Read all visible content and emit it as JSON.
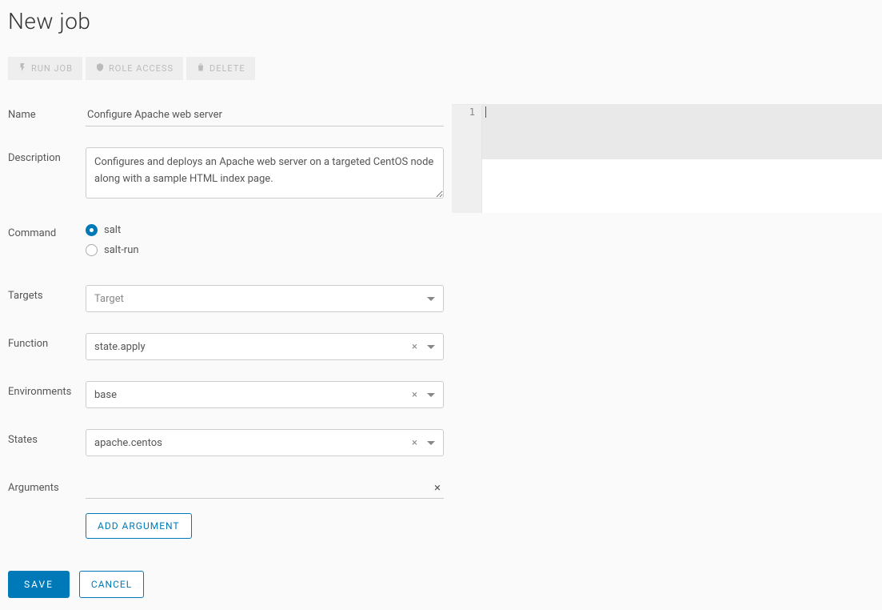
{
  "title": "New job",
  "toolbar": {
    "run_job": "RUN JOB",
    "role_access": "ROLE ACCESS",
    "delete": "DELETE"
  },
  "labels": {
    "name": "Name",
    "description": "Description",
    "command": "Command",
    "targets": "Targets",
    "function": "Function",
    "environments": "Environments",
    "states": "States",
    "arguments": "Arguments"
  },
  "form": {
    "name": "Configure Apache web server",
    "description": "Configures and deploys an Apache web server on a targeted CentOS node along with a sample HTML index page.",
    "command_options": {
      "salt": "salt",
      "salt_run": "salt-run"
    },
    "command_selected": "salt",
    "targets_placeholder": "Target",
    "function": "state.apply",
    "environments": "base",
    "states": "apache.centos",
    "argument_value": ""
  },
  "buttons": {
    "add_argument": "ADD ARGUMENT",
    "save": "SAVE",
    "cancel": "CANCEL"
  },
  "editor": {
    "line_number": "1"
  }
}
